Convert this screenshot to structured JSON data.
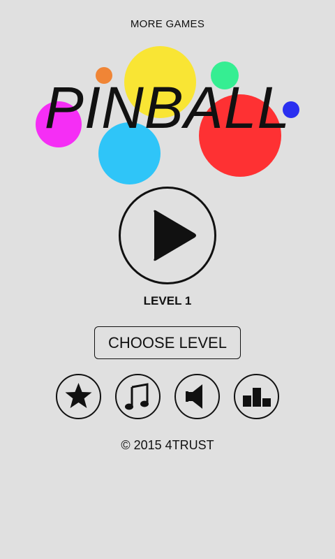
{
  "top_link": {
    "label": "MORE GAMES"
  },
  "title": "PINBALL",
  "colors": {
    "background": "#e0e0e0",
    "yellow": "#f9e534",
    "orange": "#f08536",
    "green": "#35ee92",
    "magenta": "#f52ef5",
    "red": "#fe3133",
    "blue": "#2a2ff0",
    "cyan": "#2fc5f8"
  },
  "play": {
    "icon": "play-icon"
  },
  "level": {
    "label": "LEVEL 1"
  },
  "choose_level": {
    "label": "CHOOSE LEVEL"
  },
  "icon_buttons": [
    {
      "icon": "star-icon"
    },
    {
      "icon": "music-note-icon"
    },
    {
      "icon": "speaker-icon"
    },
    {
      "icon": "leaderboard-icon"
    }
  ],
  "footer": {
    "copyright": "© 2015 4TRUST"
  }
}
